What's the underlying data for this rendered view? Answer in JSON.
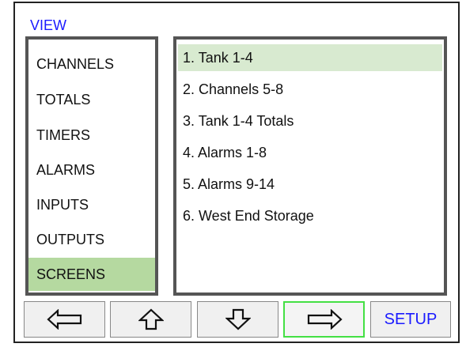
{
  "view_title": "VIEW",
  "left_menu": {
    "items": [
      {
        "label": "CHANNELS"
      },
      {
        "label": "TOTALS"
      },
      {
        "label": "TIMERS"
      },
      {
        "label": "ALARMS"
      },
      {
        "label": "INPUTS"
      },
      {
        "label": "OUTPUTS"
      },
      {
        "label": "SCREENS"
      }
    ],
    "selected_index": 6
  },
  "screens_list": {
    "items": [
      {
        "label": "1. Tank 1-4"
      },
      {
        "label": "2. Channels 5-8"
      },
      {
        "label": "3. Tank 1-4 Totals"
      },
      {
        "label": "4. Alarms 1-8"
      },
      {
        "label": "5. Alarms 9-14"
      },
      {
        "label": "6. West End Storage"
      }
    ],
    "selected_index": 0
  },
  "nav_buttons": {
    "left_icon": "arrow-left-icon",
    "up_icon": "arrow-up-icon",
    "down_icon": "arrow-down-icon",
    "right_icon": "arrow-right-icon",
    "setup_label": "SETUP"
  },
  "colors": {
    "title_blue": "#1a1aff",
    "selected_green": "#b5d9a0",
    "list_selected_green": "#d8ead0",
    "active_border_green": "#44e044"
  }
}
